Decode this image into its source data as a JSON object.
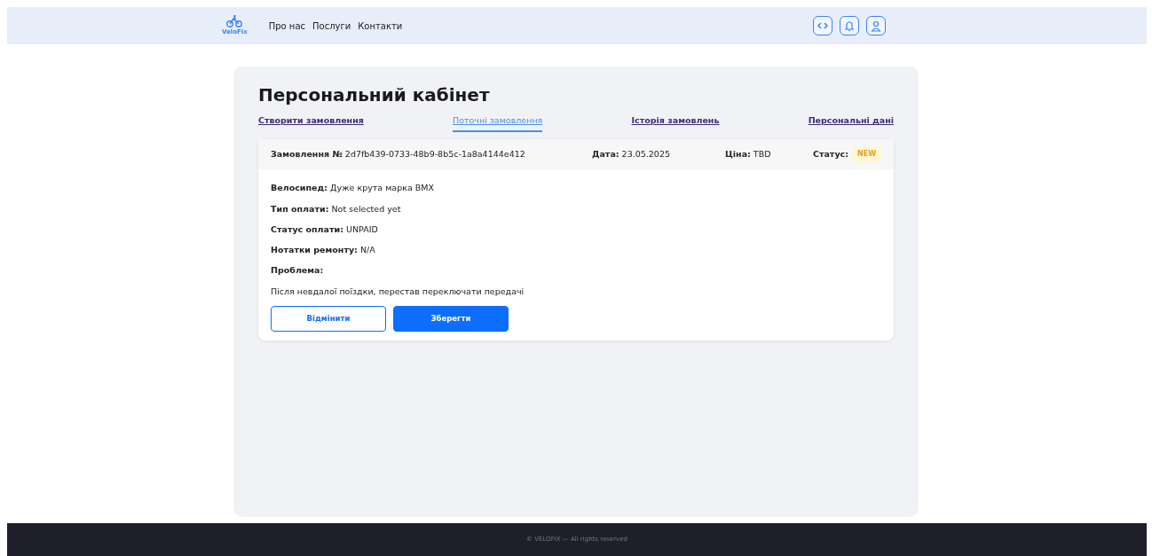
{
  "navbar": {
    "logo_text": "VeloFix",
    "links": [
      "Про нас",
      "Послуги",
      "Контакти"
    ]
  },
  "page": {
    "title": "Персональний кабінет",
    "tabs": [
      {
        "label": "Створити замовлення",
        "selected": false
      },
      {
        "label": "Поточні замовлення",
        "selected": true
      },
      {
        "label": "Історія замовлень",
        "selected": false
      },
      {
        "label": "Персональні дані",
        "selected": false
      }
    ],
    "order": {
      "number_label": "Замовлення №",
      "number": "2d7fb439-0733-48b9-8b5c-1a8a4144e412",
      "date_label": "Дата:",
      "date": "23.05.2025",
      "price_label": "Ціна:",
      "price": "TBD",
      "status_label": "Статус:",
      "status": "NEW",
      "fields": [
        {
          "label": "Велосипед:",
          "value": "Дуже крута марка BMX"
        },
        {
          "label": "Тип оплати:",
          "value": "Not selected yet"
        },
        {
          "label": "Статус оплати:",
          "value": "UNPAID"
        },
        {
          "label": "Нотатки ремонту:",
          "value": "N/A"
        }
      ],
      "problem_label": "Проблема:",
      "problem": "Після невдалої поїздки, перестав переключати передачі",
      "buttons": [
        {
          "label": "Відмінити",
          "kind": "outline"
        },
        {
          "label": "Зберегти",
          "kind": "primary"
        }
      ]
    }
  },
  "footer": {
    "text": "© VELOFIX — All rights reserved"
  }
}
